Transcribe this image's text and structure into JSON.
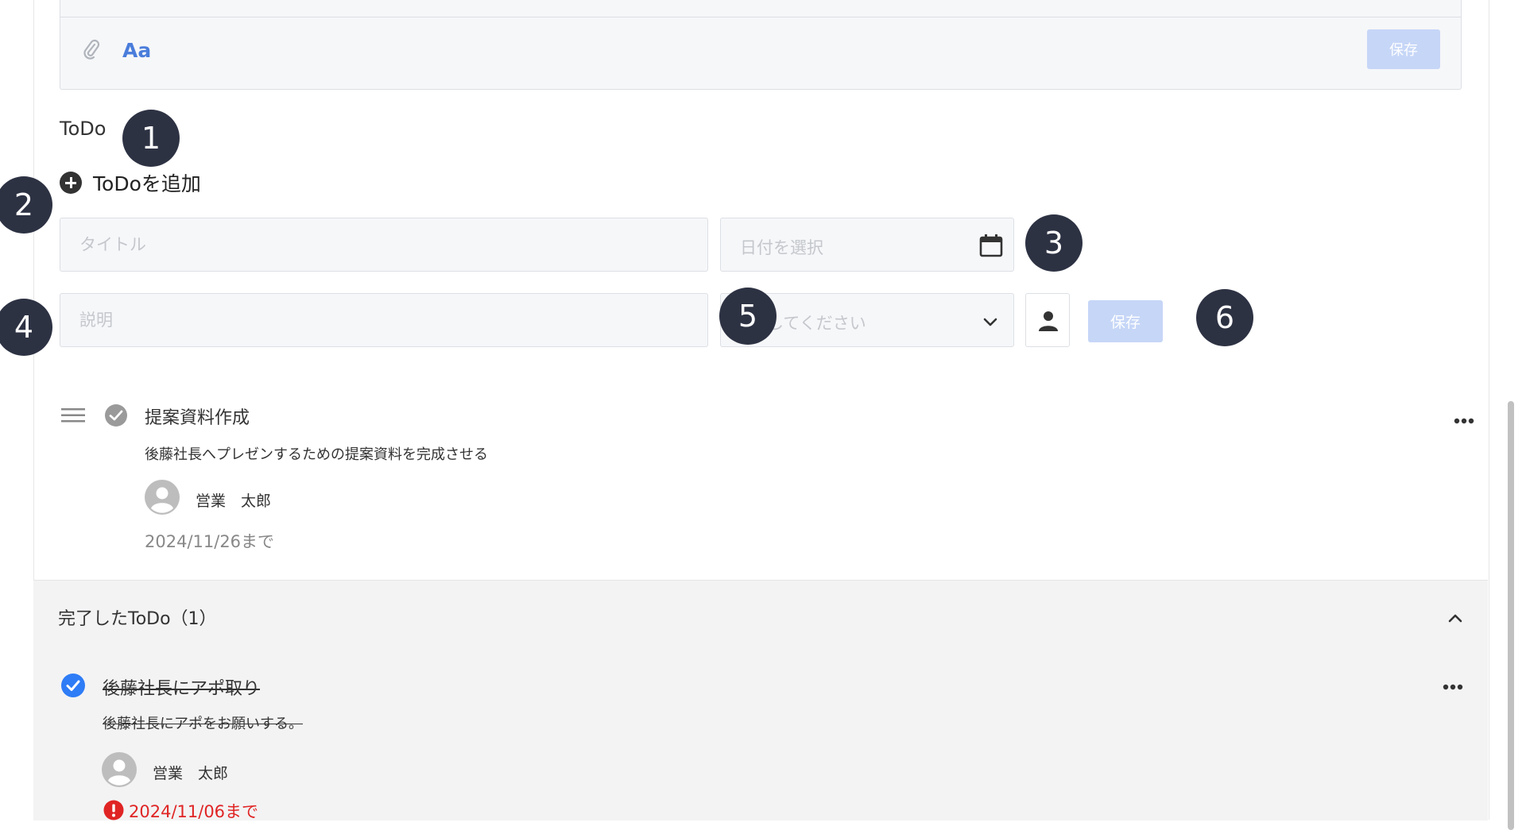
{
  "editor": {
    "format_label": "Aa",
    "save_label": "保存"
  },
  "todo_section": {
    "title": "ToDo",
    "add_label": "ToDoを追加"
  },
  "form": {
    "title_placeholder": "タイトル",
    "date_placeholder": "日付を選択",
    "description_placeholder": "説明",
    "assignee_placeholder": "選択してください",
    "assignee_visible_text": "してください",
    "save_label": "保存"
  },
  "badges": [
    "1",
    "2",
    "3",
    "4",
    "5",
    "6"
  ],
  "todos": [
    {
      "title": "提案資料作成",
      "description": "後藤社長へプレゼンするための提案資料を完成させる",
      "assignee": "営業　太郎",
      "due": "2024/11/26まで"
    }
  ],
  "done_section": {
    "header": "完了したToDo（1）",
    "items": [
      {
        "title": "後藤社長にアポ取り",
        "description": "後藤社長にアポをお願いする。",
        "assignee": "営業　太郎",
        "due": "2024/11/06まで",
        "overdue": true
      }
    ]
  },
  "colors": {
    "accent": "#2e7cf6",
    "save_disabled": "#c6d6f7",
    "badge": "#2d3243",
    "error": "#e02424"
  },
  "icons": {
    "attach": "paperclip-icon",
    "calendar": "calendar-icon",
    "chevron_down": "chevron-down-icon",
    "person": "person-icon",
    "drag": "drag-handle-icon",
    "more": "more-icon",
    "chevron_up": "chevron-up-icon"
  }
}
